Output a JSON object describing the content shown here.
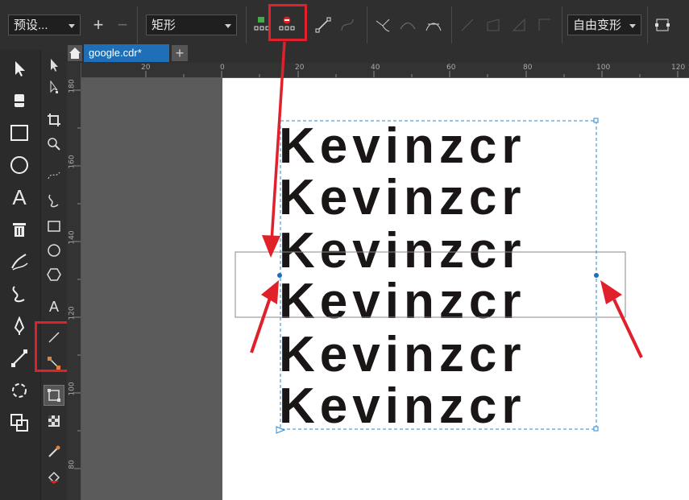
{
  "propbar": {
    "preset_value": "预设...",
    "shape_value": "矩形",
    "transform_value": "自由变形"
  },
  "tabs": {
    "document_title": "google.cdr*",
    "add_label": "+"
  },
  "ruler": {
    "h_labels": [
      "20",
      "0",
      "20",
      "40",
      "60",
      "80",
      "100",
      "120"
    ],
    "v_labels": [
      "180",
      "160",
      "140",
      "120",
      "100",
      "80"
    ]
  },
  "canvas": {
    "text_lines": [
      "Kevinzcr",
      "Kevinzcr",
      "Kevinzcr",
      "Kevinzcr",
      "Kevinzcr",
      "Kevinzcr"
    ]
  },
  "colors": {
    "accent": "#1e6fb8",
    "highlight": "#e0202a",
    "text": "#1a1616",
    "selection": "#2a8ad4"
  }
}
